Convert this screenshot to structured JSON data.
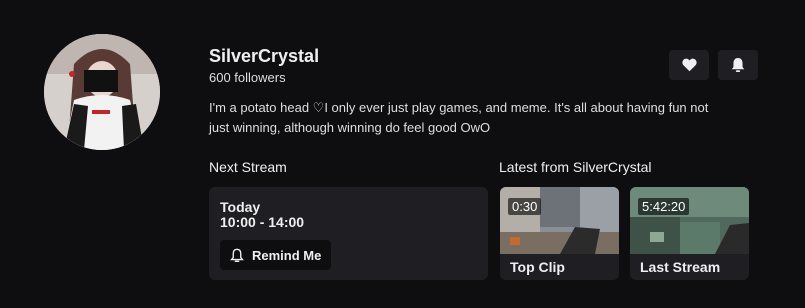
{
  "channel": {
    "name": "SilverCrystal",
    "followers": "600 followers",
    "bio": "I'm a potato head ♡I only ever just play games, and meme. It's all about having fun not just winning, although winning do feel good OwO",
    "avatar_icon": "profile-avatar"
  },
  "actions": {
    "follow_icon": "heart-icon",
    "notify_icon": "bell-icon"
  },
  "next_stream": {
    "title": "Next Stream",
    "day": "Today",
    "time": "10:00 - 14:00",
    "remind_label": "Remind Me",
    "remind_icon": "bell-icon"
  },
  "latest": {
    "title": "Latest from SilverCrystal",
    "videos": [
      {
        "duration": "0:30",
        "label": "Top Clip"
      },
      {
        "duration": "5:42:20",
        "label": "Last Stream"
      }
    ]
  },
  "colors": {
    "background": "#0e0e10",
    "card": "#1f1f23",
    "text": "#efeff1"
  }
}
